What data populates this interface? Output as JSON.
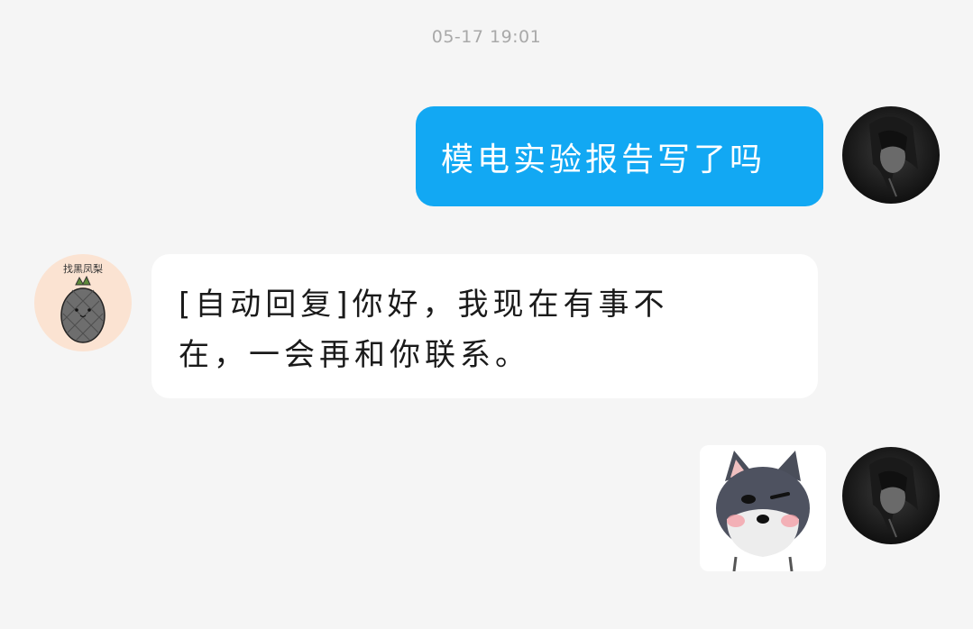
{
  "timestamp": "05-17 19:01",
  "messages": [
    {
      "sender": "self",
      "type": "text",
      "text": "模电实验报告写了吗"
    },
    {
      "sender": "peer",
      "type": "text",
      "lines": [
        "[自动回复]你好，我现在有事不",
        "在，一会再和你联系。"
      ]
    },
    {
      "sender": "self",
      "type": "sticker",
      "sticker": "husky-dog-sticker"
    }
  ],
  "peer_avatar": {
    "icon": "pineapple-icon",
    "caption": "找黑凤梨"
  },
  "self_avatar": {
    "icon": "dark-anime-girl-avatar"
  },
  "colors": {
    "background": "#f5f5f5",
    "outgoing_bubble": "#12a8f3",
    "incoming_bubble": "#ffffff",
    "timestamp": "#a9a9a9"
  }
}
